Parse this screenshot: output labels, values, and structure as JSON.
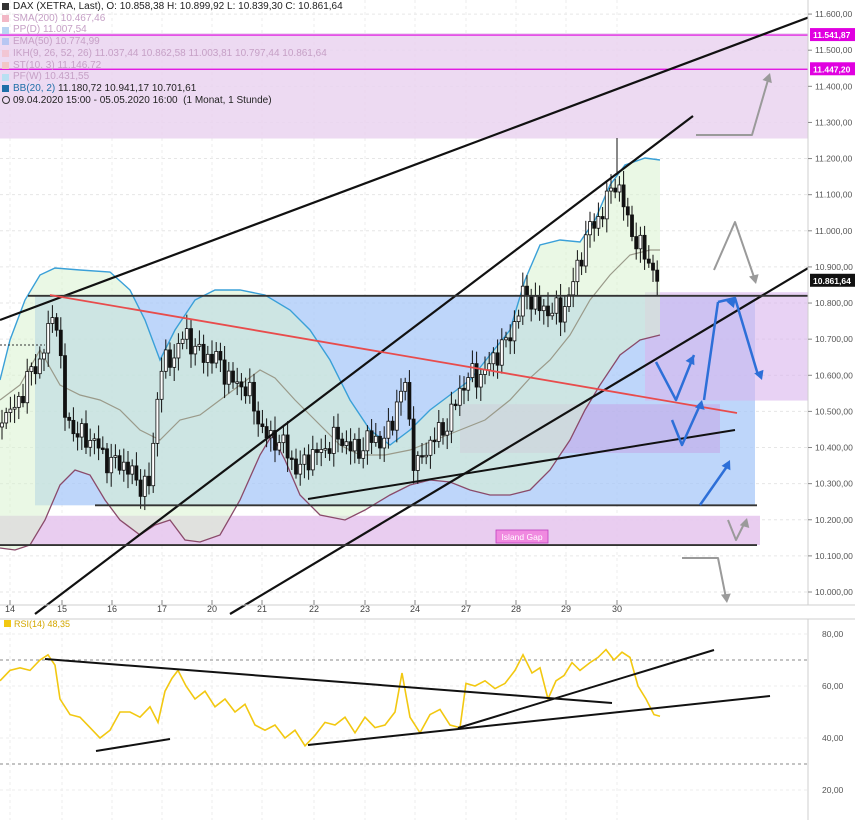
{
  "header": {
    "instrument": "DAX (XETRA, Last)",
    "ohlc": "O: 10.858,38  H: 10.899,92  L: 10.839,30  C: 10.861,64",
    "indicators": [
      {
        "label": "SMA(200)",
        "value": "10.467,46",
        "color": "#f2b8c6"
      },
      {
        "label": "PP(D)",
        "value": "11.007,54",
        "color": "#b8d4f2"
      },
      {
        "label": "EMA(50)",
        "value": "10.774,99",
        "color": "#b8c6f2"
      },
      {
        "label": "IKH(9, 26, 52, 26)",
        "value": "11.037,44  10.862,58  11.003,81  10.797,44  10.861,64",
        "color": "#f2c6d4"
      },
      {
        "label": "ST(10, 3)",
        "value": "11.146,72",
        "color": "#f2c6c6"
      },
      {
        "label": "PF(W)",
        "value": "10.431,55",
        "color": "#b8e0f2"
      }
    ],
    "bb": {
      "label": "BB(20, 2)",
      "value": "11.180,72  10.941,17  10.701,61",
      "color": "#1f6fa8"
    },
    "range": "09.04.2020 15:00 - 05.05.2020 16:00",
    "interval": "(1 Monat, 1 Stunde)"
  },
  "price_axis": {
    "ticks": [
      "11.600,00",
      "11.500,00",
      "11.400,00",
      "11.300,00",
      "11.200,00",
      "11.100,00",
      "11.000,00",
      "10.900,00",
      "10.800,00",
      "10.700,00",
      "10.600,00",
      "10.500,00",
      "10.400,00",
      "10.300,00",
      "10.200,00",
      "10.100,00",
      "10.000,00"
    ],
    "tick_values": [
      11600,
      11500,
      11400,
      11300,
      11200,
      11100,
      11000,
      10900,
      10800,
      10700,
      10600,
      10500,
      10400,
      10300,
      10200,
      10100,
      10000
    ],
    "markers": [
      {
        "label": "11.541,87",
        "value": 11541.87,
        "color": "#e000e0"
      },
      {
        "label": "11.447,20",
        "value": 11447.2,
        "color": "#e000e0"
      },
      {
        "label": "10.861,64",
        "value": 10861.64,
        "color": "#111111"
      }
    ]
  },
  "time_axis": {
    "labels": [
      "14",
      "15",
      "16",
      "17",
      "20",
      "21",
      "22",
      "23",
      "24",
      "27",
      "28",
      "29",
      "30"
    ]
  },
  "annotations": {
    "island_gap": "Island Gap"
  },
  "rsi": {
    "label": "RSI(14)",
    "value": "48,35",
    "ticks": [
      "80,00",
      "60,00",
      "40,00",
      "20,00"
    ],
    "tick_values": [
      80,
      60,
      40,
      20
    ]
  },
  "colors": {
    "candles": "#111111",
    "bb": "#3aa0d8",
    "rsi": "#f2c811",
    "fill_blue": "#a8c8f8",
    "fill_purple": "#e7c8ee",
    "fill_green": "#d8f2d0",
    "trend_red": "#e84c4c",
    "arrow_blue": "#2d6fd8",
    "arrow_gray": "#9a9a9a"
  },
  "chart_data": [
    {
      "type": "candlestick",
      "title": "DAX (XETRA, Last)",
      "x_categories": [
        "14",
        "15",
        "16",
        "17",
        "20",
        "21",
        "22",
        "23",
        "24",
        "27",
        "28",
        "29",
        "30"
      ],
      "ylim": [
        9950,
        11650
      ],
      "close_path": [
        {
          "x": "13",
          "y": 10490
        },
        {
          "x": "14",
          "y": 10640
        },
        {
          "x": "15",
          "y": 10800
        },
        {
          "x": "15",
          "y": 10480
        },
        {
          "x": "16",
          "y": 10390
        },
        {
          "x": "16",
          "y": 10290
        },
        {
          "x": "17",
          "y": 10620
        },
        {
          "x": "17",
          "y": 10700
        },
        {
          "x": "20",
          "y": 10650
        },
        {
          "x": "20",
          "y": 10560
        },
        {
          "x": "21",
          "y": 10420
        },
        {
          "x": "21",
          "y": 10400
        },
        {
          "x": "22",
          "y": 10340
        },
        {
          "x": "22",
          "y": 10420
        },
        {
          "x": "23",
          "y": 10400
        },
        {
          "x": "23",
          "y": 10430
        },
        {
          "x": "24",
          "y": 10570
        },
        {
          "x": "24",
          "y": 10350
        },
        {
          "x": "27",
          "y": 10440
        },
        {
          "x": "27",
          "y": 10600
        },
        {
          "x": "28",
          "y": 10620
        },
        {
          "x": "28",
          "y": 10720
        },
        {
          "x": "29",
          "y": 10820
        },
        {
          "x": "29",
          "y": 10760
        },
        {
          "x": "30",
          "y": 11000
        },
        {
          "x": "30",
          "y": 11130
        },
        {
          "x": "30",
          "y": 10950
        },
        {
          "x": "30",
          "y": 10861.64
        }
      ],
      "levels": [
        10820,
        10240,
        10130
      ],
      "bands": [
        {
          "name": "BB(20, 2)",
          "value": "11.180,72  10.941,17  10.701,61"
        }
      ]
    },
    {
      "type": "line",
      "title": "RSI(14)",
      "ylim": [
        15,
        85
      ],
      "series": [
        {
          "name": "RSI(14)",
          "last": 48.35
        }
      ],
      "values_points": [
        [
          0,
          62
        ],
        [
          10,
          66
        ],
        [
          20,
          67
        ],
        [
          30,
          66
        ],
        [
          40,
          70
        ],
        [
          48,
          72
        ],
        [
          55,
          68
        ],
        [
          60,
          55
        ],
        [
          70,
          49
        ],
        [
          80,
          48
        ],
        [
          90,
          44
        ],
        [
          100,
          40
        ],
        [
          110,
          43
        ],
        [
          120,
          50
        ],
        [
          130,
          50
        ],
        [
          140,
          48
        ],
        [
          150,
          52
        ],
        [
          158,
          46
        ],
        [
          165,
          58
        ],
        [
          172,
          63
        ],
        [
          178,
          66
        ],
        [
          186,
          60
        ],
        [
          195,
          55
        ],
        [
          205,
          58
        ],
        [
          215,
          52
        ],
        [
          225,
          55
        ],
        [
          235,
          50
        ],
        [
          245,
          53
        ],
        [
          255,
          45
        ],
        [
          265,
          43
        ],
        [
          275,
          45
        ],
        [
          285,
          40
        ],
        [
          295,
          43
        ],
        [
          305,
          37
        ],
        [
          315,
          41
        ],
        [
          325,
          46
        ],
        [
          335,
          45
        ],
        [
          345,
          48
        ],
        [
          355,
          42
        ],
        [
          365,
          48
        ],
        [
          375,
          44
        ],
        [
          385,
          45
        ],
        [
          395,
          50
        ],
        [
          402,
          65
        ],
        [
          410,
          48
        ],
        [
          420,
          42
        ],
        [
          430,
          49
        ],
        [
          440,
          51
        ],
        [
          450,
          45
        ],
        [
          460,
          44
        ],
        [
          466,
          61
        ],
        [
          475,
          60
        ],
        [
          485,
          62
        ],
        [
          495,
          59
        ],
        [
          505,
          61
        ],
        [
          515,
          66
        ],
        [
          523,
          72
        ],
        [
          532,
          65
        ],
        [
          540,
          67
        ],
        [
          548,
          55
        ],
        [
          556,
          62
        ],
        [
          564,
          64
        ],
        [
          572,
          69
        ],
        [
          580,
          66
        ],
        [
          590,
          69
        ],
        [
          598,
          71
        ],
        [
          606,
          74
        ],
        [
          614,
          70
        ],
        [
          622,
          73
        ],
        [
          630,
          71
        ],
        [
          638,
          60
        ],
        [
          646,
          55
        ],
        [
          654,
          49
        ],
        [
          660,
          48.35
        ]
      ]
    }
  ]
}
